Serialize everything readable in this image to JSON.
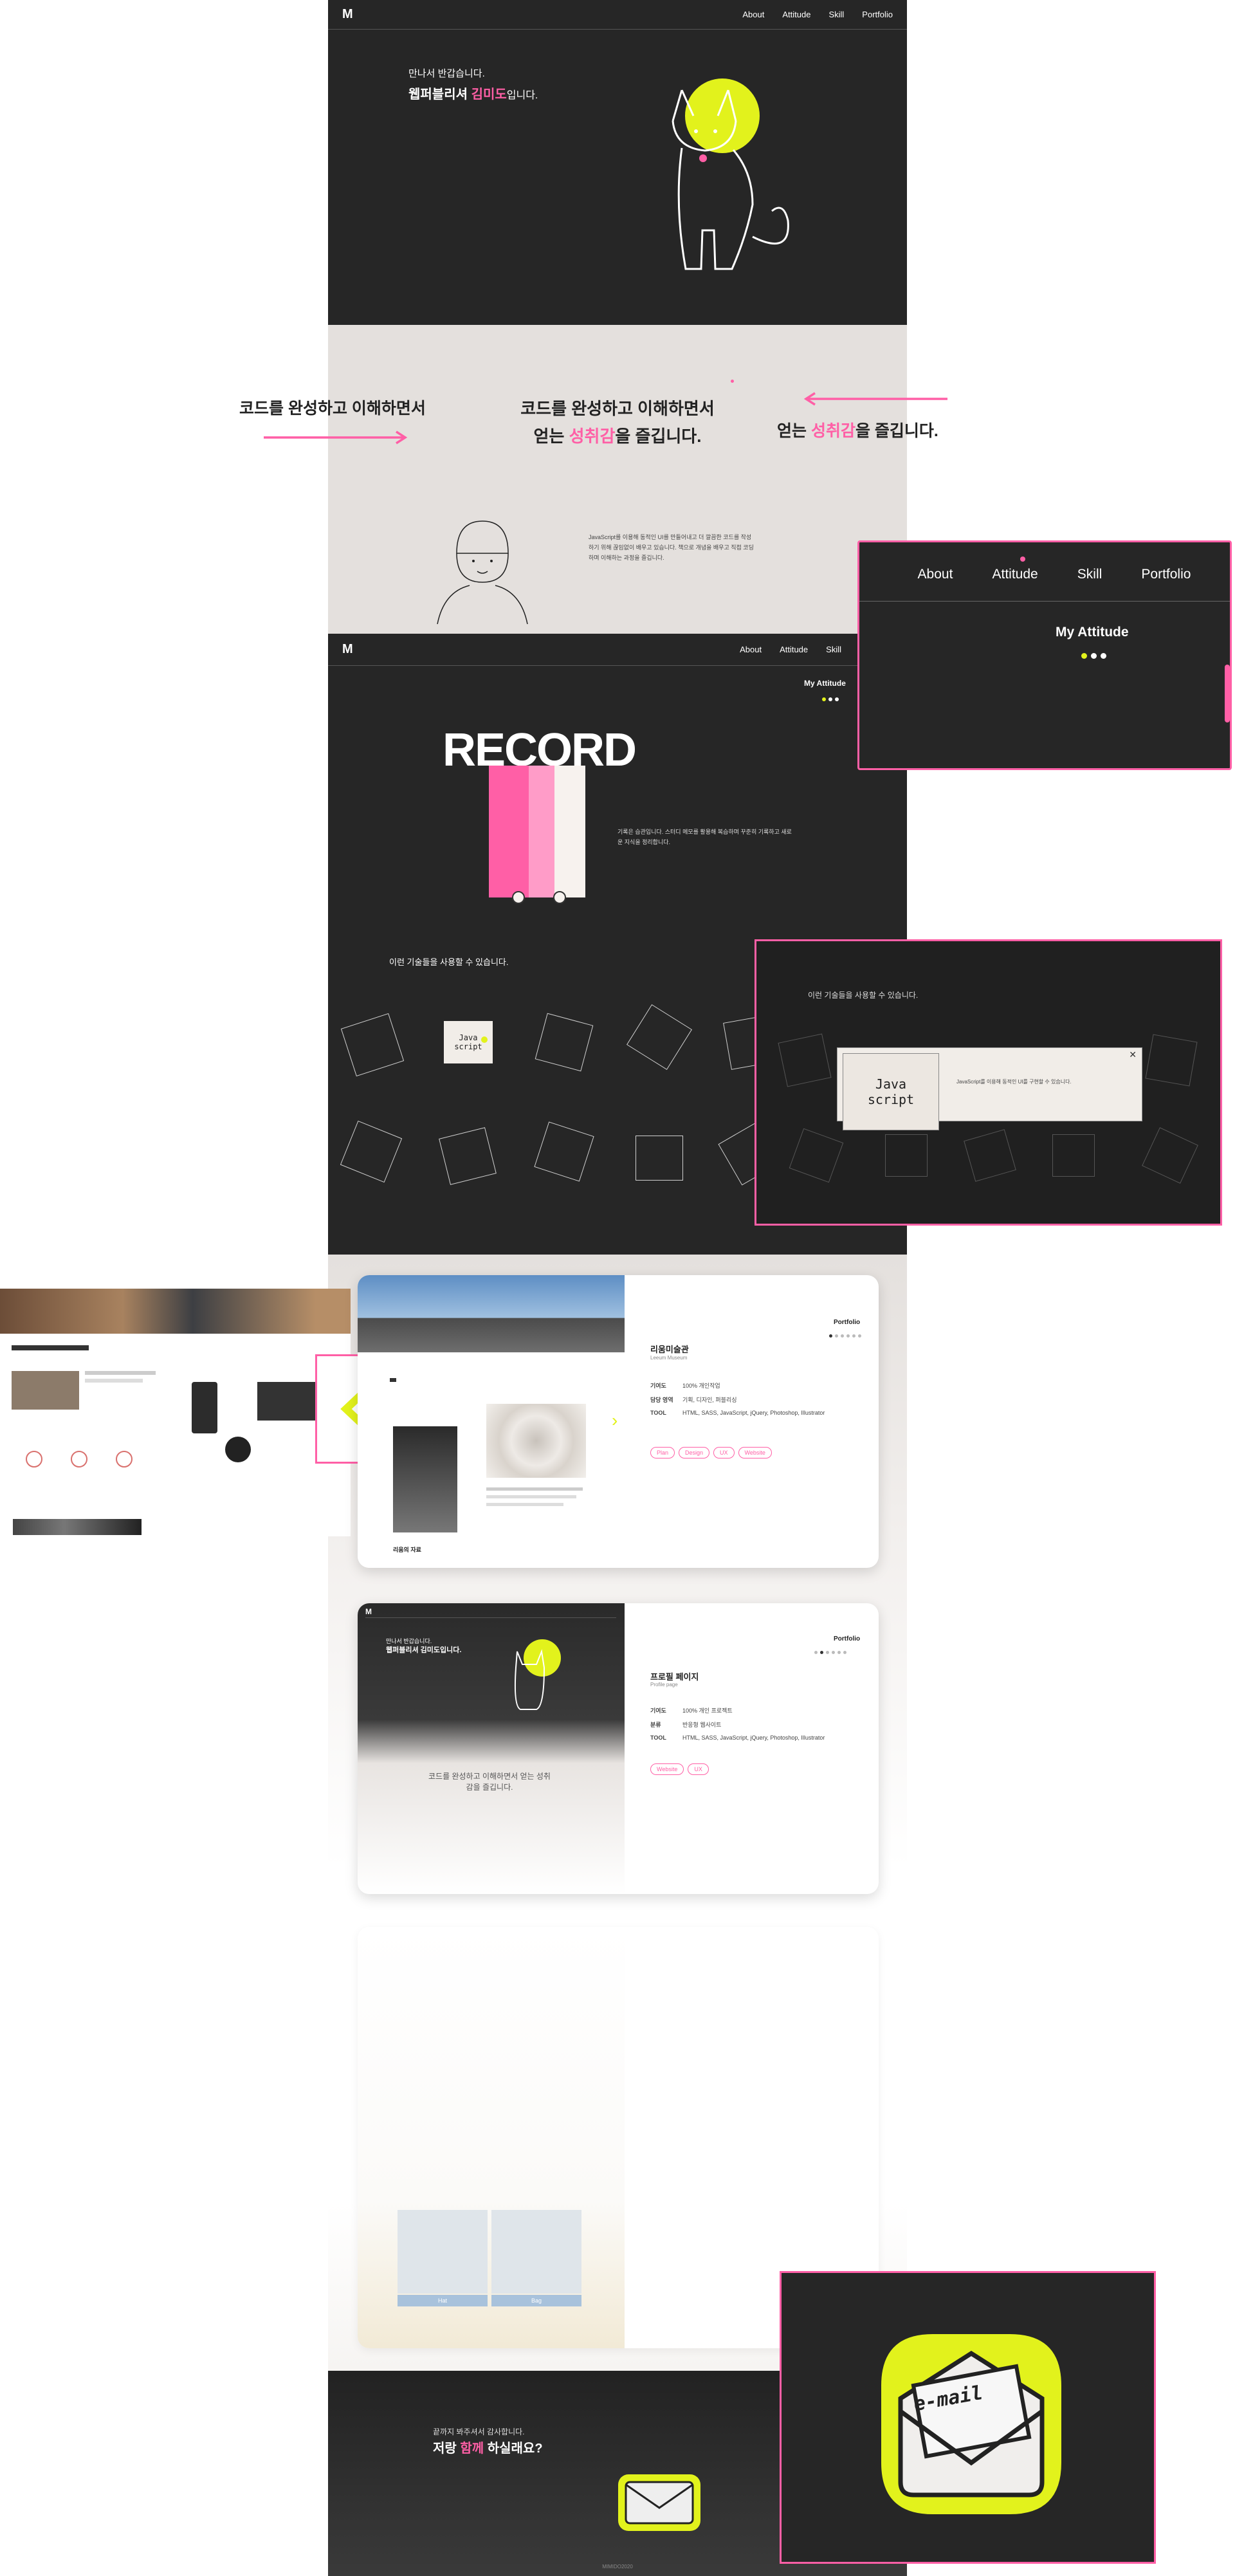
{
  "nav": {
    "logo": "M",
    "items": [
      "About",
      "Attitude",
      "Skill",
      "Portfolio"
    ]
  },
  "hero": {
    "greeting": "만나서 반갑습니다.",
    "line_prefix": "웹퍼블리셔 ",
    "name": "김미도",
    "line_suffix": "입니다."
  },
  "attitude": {
    "left_text": "코드를 완성하고 이해하면서",
    "center_line1": "코드를 완성하고 이해하면서",
    "center_line2_prefix": "얻는 ",
    "center_line2_highlight": "성취감",
    "center_line2_suffix": "을 즐깁니다.",
    "right_prefix": "얻는 ",
    "right_highlight": "성취감",
    "right_suffix": "을 즐깁니다.",
    "paragraph": "JavaScript를 이용해 동적인 UI를 만들어내고 더 깔끔한 코드를 작성하기 위해 끊임없이 배우고 있습니다. 책으로 개념을 배우고 직접 코딩하며 이해하는 과정을 즐깁니다."
  },
  "zoom_nav": {
    "items": [
      "About",
      "Attitude",
      "Skill",
      "Portfolio"
    ],
    "title": "My Attitude"
  },
  "record": {
    "nav_items": [
      "About",
      "Attitude",
      "Skill"
    ],
    "my_attitude": "My Attitude",
    "title": "RECORD",
    "paragraph": "기록은 습관입니다. 스터디 메모를 활용해 복습하며 꾸준히 기록하고 새로운 지식을 정리합니다."
  },
  "skill": {
    "heading": "이런 기술들을 사용할 수 있습니다.",
    "cube_label": "Java script",
    "popup_heading": "이런 기술들을 사용할 수 있습니다.",
    "popup_cube_label": "Java script",
    "popup_text": "JavaScript를 이용해 동적인 UI를 구현할 수 있습니다.",
    "popup_close": "✕"
  },
  "portfolio1": {
    "label": "Portfolio",
    "title": "리움미술관",
    "subtitle": "Leeum Museum",
    "rows": [
      {
        "k": "기여도",
        "v": "100% 개인작업"
      },
      {
        "k": "담당 영역",
        "v": "기획, 디자인, 퍼블리싱"
      },
      {
        "k": "TOOL",
        "v": "HTML, SASS, JavaScript, jQuery, Photoshop, Illustrator"
      }
    ],
    "tags": [
      "Plan",
      "Design",
      "UX",
      "Website"
    ],
    "next": "›",
    "image_caption": "리움의 자료"
  },
  "portfolio2": {
    "label": "Portfolio",
    "title": "프로필 페이지",
    "subtitle": "Profile page",
    "rows": [
      {
        "k": "기여도",
        "v": "100% 개인 프로젝트"
      },
      {
        "k": "분류",
        "v": "반응형 웹사이트"
      },
      {
        "k": "TOOL",
        "v": "HTML, SASS, JavaScript, jQuery, Photoshop, Illustrator"
      }
    ],
    "tags": [
      "Website",
      "UX"
    ],
    "mini_greeting": "만나서 반갑습니다.",
    "mini_line": "웹퍼블리셔 김미도입니다.",
    "mini_center": "코드를 완성하고 이해하면서 얻는 성취감을 즐깁니다."
  },
  "portfolio3": {
    "btn1": "Hat",
    "btn2": "Bag"
  },
  "contact": {
    "line1": "끝까지 봐주셔서 감사합니다.",
    "line2_prefix": "저랑 ",
    "line2_highlight": "함께",
    "line2_suffix": " 하실래요?",
    "footer": "MIMIDO2020"
  },
  "email_sticker": "e-mail",
  "colors": {
    "dark": "#262626",
    "pink": "#ff5fa6",
    "lime": "#e2f21c",
    "beige": "#e4e0dd"
  }
}
